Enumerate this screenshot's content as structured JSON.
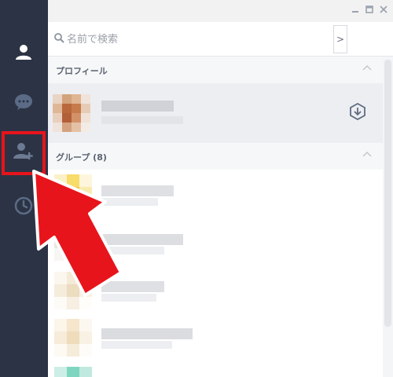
{
  "window": {
    "controls": [
      "minimize",
      "maximize",
      "close"
    ]
  },
  "sidebar": {
    "items": [
      {
        "icon": "person-icon"
      },
      {
        "icon": "chat-bubble-icon"
      },
      {
        "icon": "add-friend-icon",
        "highlighted": true
      },
      {
        "icon": "clock-icon"
      }
    ]
  },
  "search": {
    "placeholder": "名前で検索",
    "side_button": ">"
  },
  "sections": {
    "profile": {
      "label": "プロフィール"
    },
    "group": {
      "label": "グループ (8)"
    }
  },
  "colors": {
    "sidebar": "#2c3345",
    "highlight": "#e8141b",
    "accent": "#5b6b86"
  }
}
